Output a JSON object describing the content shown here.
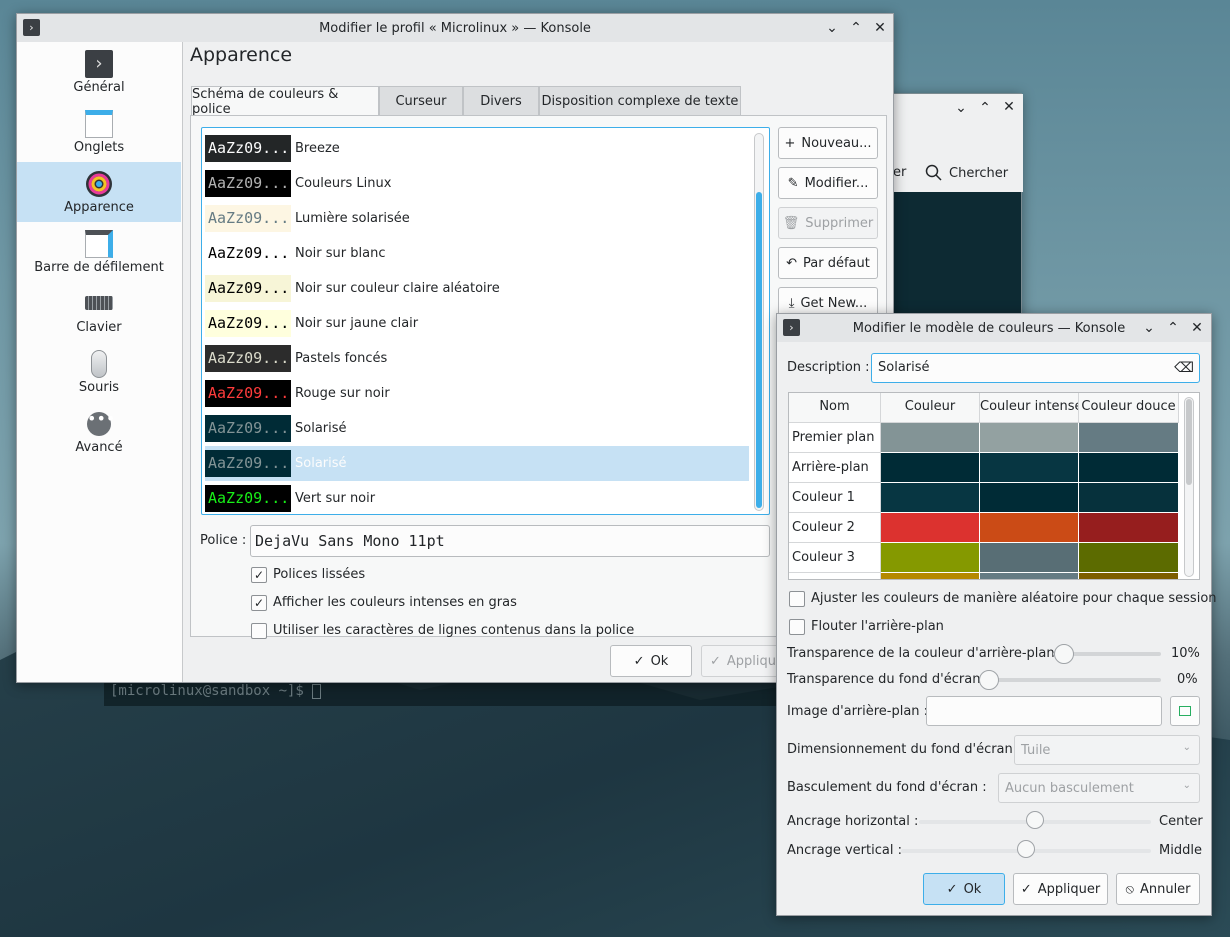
{
  "terminal_prompt": "[microlinux@sandbox ~]$ ",
  "bg_window": {
    "search_label": "Chercher",
    "partial_label": "er"
  },
  "profile_window": {
    "title": "Modifier le profil « Microlinux » — Konsole",
    "sidebar": [
      {
        "label": "Général",
        "icon": "terminal-icon"
      },
      {
        "label": "Onglets",
        "icon": "tabs-icon"
      },
      {
        "label": "Apparence",
        "icon": "appearance-icon"
      },
      {
        "label": "Barre de défilement",
        "icon": "scrollbar-icon"
      },
      {
        "label": "Clavier",
        "icon": "keyboard-icon"
      },
      {
        "label": "Souris",
        "icon": "mouse-icon"
      },
      {
        "label": "Avancé",
        "icon": "more-icon"
      }
    ],
    "page_title": "Apparence",
    "tabs": [
      "Schéma de couleurs & police",
      "Curseur",
      "Divers",
      "Disposition complexe de texte"
    ],
    "sample_text": "AaZz09...",
    "schemes": [
      {
        "name": "Breeze",
        "bg": "#232627",
        "fg": "#fcfcfc"
      },
      {
        "name": "Couleurs Linux",
        "bg": "#000000",
        "fg": "#b2b2b2"
      },
      {
        "name": "Lumière solarisée",
        "bg": "#fdf6e3",
        "fg": "#657b83"
      },
      {
        "name": "Noir sur blanc",
        "bg": "#ffffff",
        "fg": "#000000"
      },
      {
        "name": "Noir sur couleur claire aléatoire",
        "bg": "#f7f5d7",
        "fg": "#000000"
      },
      {
        "name": "Noir sur jaune clair",
        "bg": "#ffffdd",
        "fg": "#000000"
      },
      {
        "name": "Pastels foncés",
        "bg": "#2c2c2c",
        "fg": "#dcdccc"
      },
      {
        "name": "Rouge sur noir",
        "bg": "#000000",
        "fg": "#ff3c3c"
      },
      {
        "name": "Solarisé",
        "bg": "#002b36",
        "fg": "#839496"
      },
      {
        "name": "Solarisé",
        "bg": "#002b36",
        "fg": "#839496"
      },
      {
        "name": "Vert sur noir",
        "bg": "#000000",
        "fg": "#18f018"
      }
    ],
    "buttons": {
      "new": "Nouveau...",
      "edit": "Modifier...",
      "remove": "Supprimer",
      "default": "Par défaut",
      "get_new": "Get New..."
    },
    "font_label": "Police :",
    "font_value": "DejaVu Sans Mono 11pt",
    "checks": [
      {
        "label": "Polices lissées",
        "checked": "✓"
      },
      {
        "label": "Afficher les couleurs intenses en gras",
        "checked": "✓"
      },
      {
        "label": "Utiliser les caractères de lignes contenus dans la police",
        "checked": ""
      }
    ],
    "ok": "Ok",
    "apply": "Appliquer"
  },
  "color_window": {
    "title": "Modifier le modèle de couleurs — Konsole",
    "description_label": "Description :",
    "description_value": "Solarisé",
    "table_headers": [
      "Nom",
      "Couleur",
      "Couleur intense",
      "Couleur douce"
    ],
    "rows": [
      {
        "name": "Premier plan",
        "colors": [
          "#839496",
          "#93a1a1",
          "#657b83"
        ]
      },
      {
        "name": "Arrière-plan",
        "colors": [
          "#002b36",
          "#073642",
          "#002b36"
        ]
      },
      {
        "name": "Couleur 1",
        "colors": [
          "#073642",
          "#002b36",
          "#06313c"
        ]
      },
      {
        "name": "Couleur 2",
        "colors": [
          "#dc322f",
          "#cb4b16",
          "#961e1e"
        ]
      },
      {
        "name": "Couleur 3",
        "colors": [
          "#859900",
          "#586e75",
          "#5c6b00"
        ]
      },
      {
        "name": "",
        "colors": [
          "#b58900",
          "#657b83",
          "#7d5e00"
        ]
      }
    ],
    "randomize_label": "Ajuster les couleurs de manière aléatoire pour chaque session",
    "blur_label": "Flouter l'arrière-plan",
    "bg_transparency_label": "Transparence de la couleur d'arrière-plan :",
    "bg_transparency_value": "10%",
    "bg_transparency": 0.1,
    "wallpaper_transparency_label": "Transparence du fond d'écran :",
    "wallpaper_transparency_value": "0%",
    "wallpaper_transparency": 0,
    "image_label": "Image d'arrière-plan :",
    "image_value": "",
    "sizing_label": "Dimensionnement du fond d'écran :",
    "sizing_value": "Tuile",
    "flip_label": "Basculement du fond d'écran :",
    "flip_value": "Aucun basculement",
    "h_anchor_label": "Ancrage horizontal :",
    "h_anchor_value": "Center",
    "h_anchor": 0.5,
    "v_anchor_label": "Ancrage vertical :",
    "v_anchor_value": "Middle",
    "v_anchor": 0.5,
    "ok": "Ok",
    "apply": "Appliquer",
    "cancel": "Annuler"
  }
}
